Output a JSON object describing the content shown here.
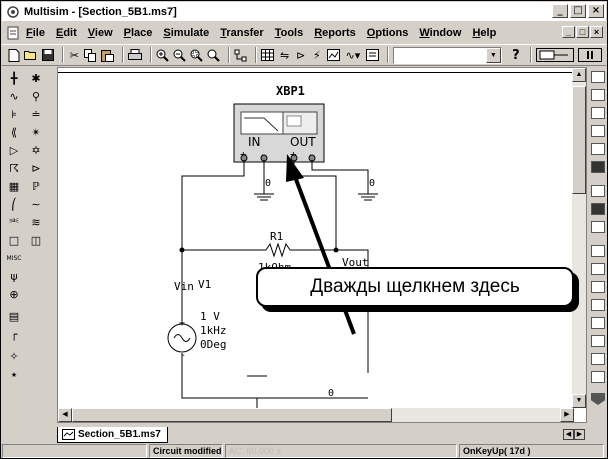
{
  "window": {
    "title": "Multisim - [Section_5B1.ms7]",
    "controls": [
      "_",
      "□",
      "×"
    ]
  },
  "menu": [
    {
      "u": "F",
      "rest": "ile"
    },
    {
      "u": "E",
      "rest": "dit"
    },
    {
      "u": "V",
      "rest": "iew"
    },
    {
      "u": "P",
      "rest": "lace"
    },
    {
      "u": "S",
      "rest": "imulate"
    },
    {
      "u": "T",
      "rest": "ransfer"
    },
    {
      "u": "T",
      "rest": "ools"
    },
    {
      "u": "R",
      "rest": "eports"
    },
    {
      "u": "O",
      "rest": "ptions"
    },
    {
      "u": "W",
      "rest": "indow"
    },
    {
      "u": "H",
      "rest": "elp"
    }
  ],
  "mdi_controls": [
    "_",
    "□",
    "×"
  ],
  "toolbar": {
    "icons": [
      "new-icon",
      "open-icon",
      "save-icon",
      "cut-icon",
      "copy-icon",
      "paste-icon",
      "print-icon",
      "zoom-in-icon",
      "zoom-out-icon",
      "zoom-area-icon",
      "zoom-fit-icon",
      "hierarchy-icon",
      "spreadsheet-icon",
      "database-icon",
      "component-wizard-icon",
      "postprocessor-icon",
      "grapher-icon",
      "analysis-icon",
      "description-icon"
    ],
    "combo_value": "",
    "help_label": "?"
  },
  "schematic": {
    "instrument_label": "XBP1",
    "in_label": "IN",
    "out_label": "OUT",
    "resistor_ref": "R1",
    "resistor_value": "1kOhm",
    "node_in": "Vin",
    "source_ref": "V1",
    "source_amp": "1 V",
    "source_freq": "1kHz",
    "source_phase": "0Deg",
    "node_out": "Vout",
    "ground_node_1": "0",
    "ground_node_2": "0",
    "ground_node_3": "0"
  },
  "callout": {
    "text": "Дважды щелкнем здесь"
  },
  "tab": {
    "label": "Section_5B1.ms7"
  },
  "status": {
    "message": "Circuit modified",
    "time": "AC: 60.000 s",
    "event": "OnKeyUp( 17d )"
  }
}
